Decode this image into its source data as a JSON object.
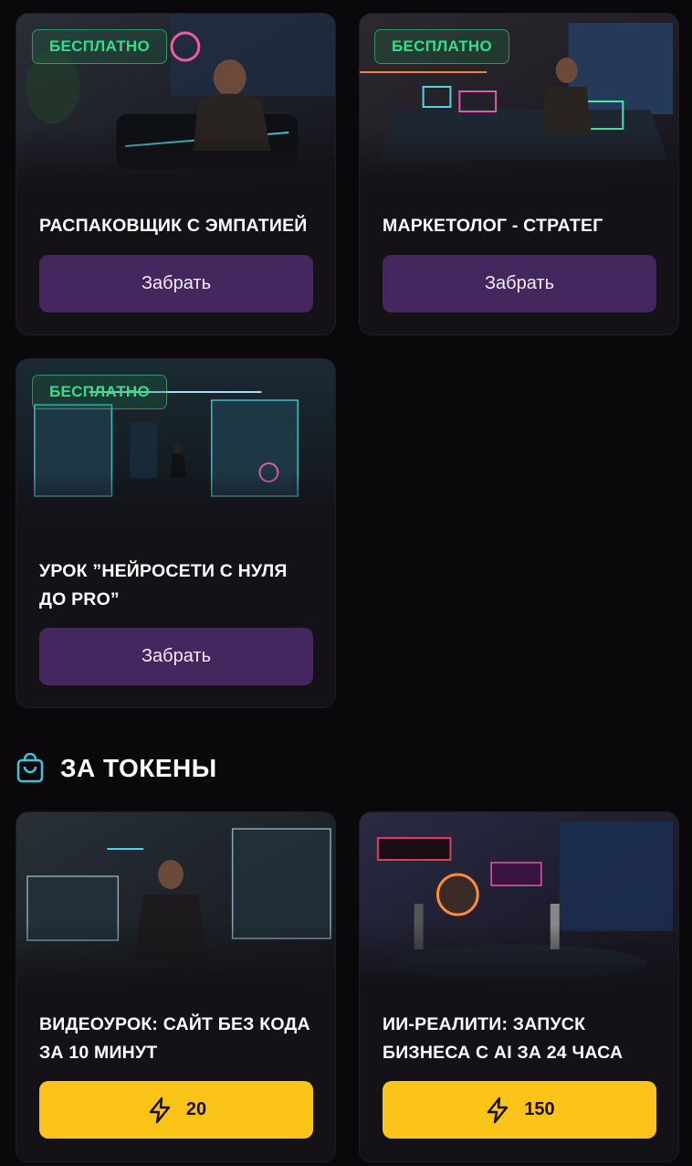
{
  "colors": {
    "background": "#0a080b",
    "card": "#141216",
    "claim_button": "#45275f",
    "token_button": "#fcc419",
    "free_badge": "#2fe08a",
    "section_icon": "#39c6d9"
  },
  "free_items": [
    {
      "badge": "БЕСПЛАТНО",
      "title": "РАСПАКОВЩИК С ЭМПАТИЕЙ",
      "button": "Забрать"
    },
    {
      "badge": "БЕСПЛАТНО",
      "title": "МАРКЕТОЛОГ - СТРАТЕГ",
      "button": "Забрать"
    },
    {
      "badge": "БЕСПЛАТНО",
      "title": "УРОК ”НЕЙРОСЕТИ С НУЛЯ ДО PRO”",
      "button": "Забрать"
    }
  ],
  "tokens_section": {
    "icon": "shopping-bag-icon",
    "title": "ЗА ТОКЕНЫ"
  },
  "token_items": [
    {
      "title": "ВИДЕОУРОК: САЙТ БЕЗ КОДА ЗА 10 МИНУТ",
      "price": "20",
      "price_icon": "lightning-icon"
    },
    {
      "title": "ИИ-РЕАЛИТИ: ЗАПУСК БИЗНЕСА С AI ЗА 24 ЧАСА",
      "price": "150",
      "price_icon": "lightning-icon"
    }
  ]
}
